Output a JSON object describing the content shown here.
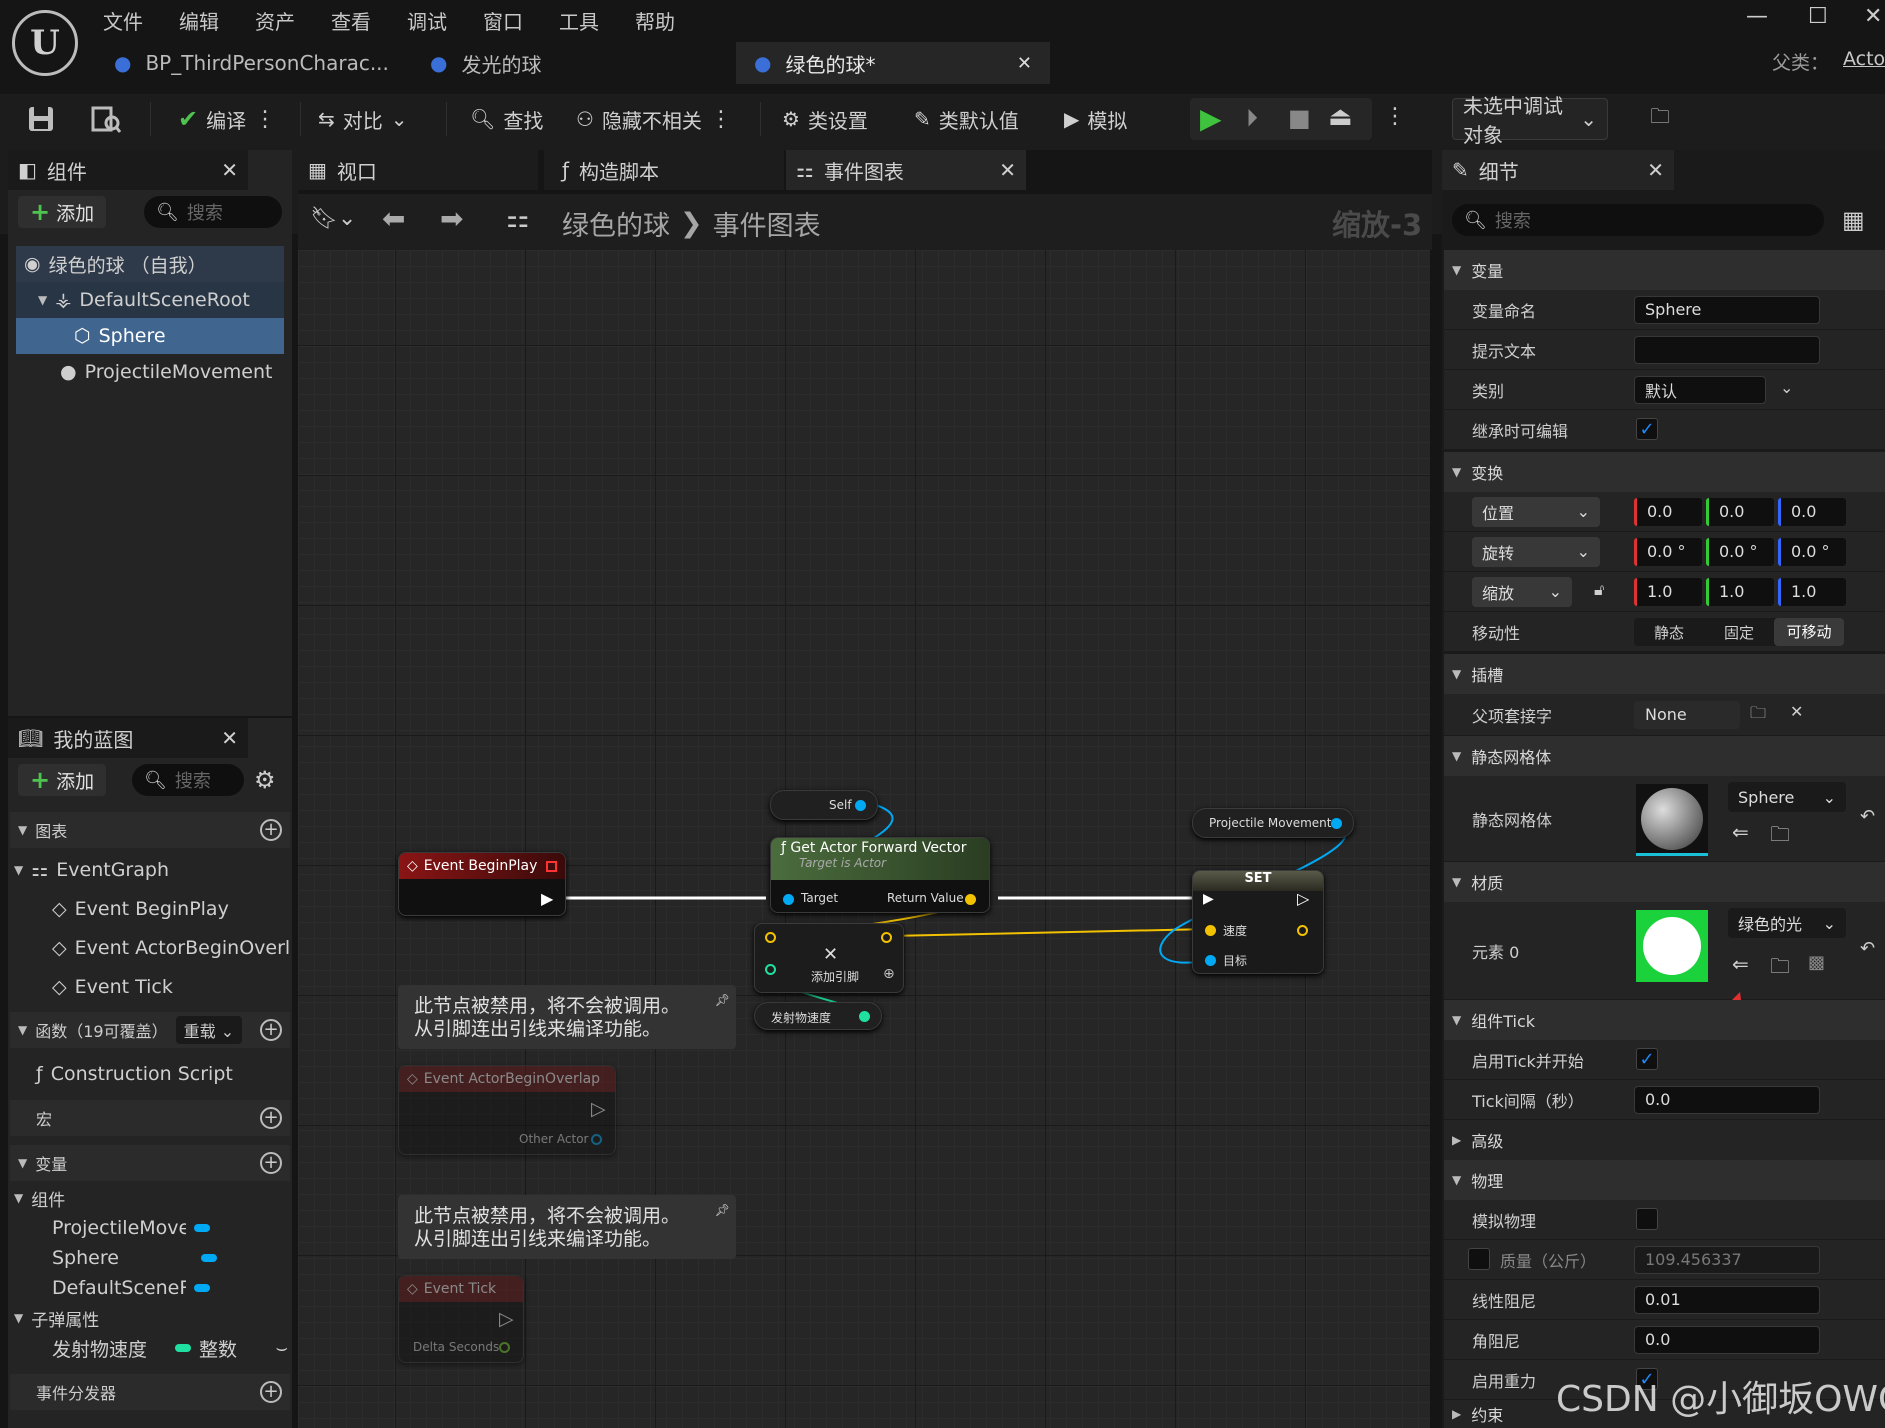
{
  "menu": [
    "文件",
    "编辑",
    "资产",
    "查看",
    "调试",
    "窗口",
    "工具",
    "帮助"
  ],
  "doc_tabs": [
    {
      "label": "BP_ThirdPersonCharac..."
    },
    {
      "label": "发光的球"
    },
    {
      "label": "绿色的球*"
    }
  ],
  "parent_label": "父类：",
  "parent_value": "Acto",
  "toolbar": {
    "compile": "编译",
    "diff": "对比",
    "find": "查找",
    "hide": "隐藏不相关",
    "class_settings": "类设置",
    "class_defaults": "类默认值",
    "simulate": "模拟",
    "debug_target": "未选中调试对象"
  },
  "components": {
    "title": "组件",
    "add": "添加",
    "search": "搜索",
    "items": [
      "绿色的球 （自我）",
      "DefaultSceneRoot",
      "Sphere",
      "ProjectileMovement"
    ]
  },
  "editor_tabs": [
    "视口",
    "构造脚本",
    "事件图表"
  ],
  "breadcrumb": {
    "root": "绿色的球",
    "sep": "❯",
    "page": "事件图表",
    "zoom": "缩放-3"
  },
  "my_blueprint": {
    "title": "我的蓝图",
    "add": "添加",
    "search": "搜索",
    "graphs": "图表",
    "event_graph": "EventGraph",
    "events": [
      "Event BeginPlay",
      "Event ActorBeginOverla",
      "Event Tick"
    ],
    "functions": "函数（19可覆盖）",
    "override": "重载",
    "construction": "Construction Script",
    "macros": "宏",
    "variables": "变量",
    "components_cat": "组件",
    "var_components": [
      "ProjectileMove",
      "Sphere",
      "DefaultSceneR"
    ],
    "bullet_cat": "子弹属性",
    "bullet_var": "发射物速度",
    "bullet_type": "整数",
    "dispatchers": "事件分发器"
  },
  "graph_nodes": {
    "begin_play": "Event BeginPlay",
    "self": "Self",
    "forward_title": "Get Actor Forward Vector",
    "forward_sub": "Target is Actor",
    "forward_target": "Target",
    "forward_return": "Return Value",
    "projectile": "Projectile Movement",
    "set": "SET",
    "set_speed": "速度",
    "set_target": "目标",
    "multiply_add": "添加引脚",
    "launch_speed": "发射物速度",
    "disabled_comment_1": "此节点被禁用，将不会被调用。",
    "disabled_comment_2": "从引脚连出引线来编译功能。",
    "overlap": "Event ActorBeginOverlap",
    "overlap_pin": "Other Actor",
    "tick": "Event Tick",
    "tick_pin": "Delta Seconds"
  },
  "details": {
    "title": "细节",
    "search": "搜索",
    "sec_variable": "变量",
    "var_name_label": "变量命名",
    "var_name": "Sphere",
    "tooltip_label": "提示文本",
    "tooltip": "",
    "category_label": "类别",
    "category": "默认",
    "editable_label": "继承时可编辑",
    "sec_transform": "变换",
    "location": "位置",
    "rotation": "旋转",
    "scale": "缩放",
    "loc_vals": [
      "0.0",
      "0.0",
      "0.0"
    ],
    "rot_vals": [
      "0.0 °",
      "0.0 °",
      "0.0 °"
    ],
    "scale_vals": [
      "1.0",
      "1.0",
      "1.0"
    ],
    "mobility_label": "移动性",
    "mobility": [
      "静态",
      "固定",
      "可移动"
    ],
    "sec_sockets": "插槽",
    "parent_socket_label": "父项套接字",
    "parent_socket": "None",
    "sec_static_mesh": "静态网格体",
    "static_mesh_label": "静态网格体",
    "static_mesh": "Sphere",
    "sec_materials": "材质",
    "element0_label": "元素 0",
    "element0": "绿色的光",
    "sec_tick": "组件Tick",
    "tick_start_label": "启用Tick并开始",
    "tick_interval_label": "Tick间隔（秒）",
    "tick_interval": "0.0",
    "sec_advanced": "高级",
    "sec_physics": "物理",
    "simulate_label": "模拟物理",
    "mass_label": "质量（公斤）",
    "mass": "109.456337",
    "linear_damping_label": "线性阻尼",
    "linear_damping": "0.01",
    "angular_damping_label": "角阻尼",
    "angular_damping": "0.0",
    "gravity_label": "启用重力",
    "sec_constraints": "约束"
  },
  "watermark": "CSDN @小御坂OWO",
  "colors": {
    "exec_white": "#ffffff",
    "vector_yellow": "#f2c200",
    "object_blue": "#00a9f4",
    "int_green": "#1fe0a0",
    "begin_play_red": "#7a1010",
    "accent_green": "#3fa33f"
  }
}
